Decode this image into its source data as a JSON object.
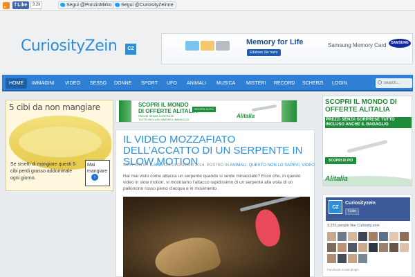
{
  "topbar": {
    "like_label": "Like",
    "like_count": "3.2k",
    "follow1": "Segui @PonzioMirko",
    "follow2": "Segui @CuriosityZeinne"
  },
  "header": {
    "logo": "CuriosityZein",
    "logo_badge": "CZ",
    "banner": {
      "title": "Memory for Life",
      "subtitle": "Samsung Memory Card",
      "cta": "Erfahren Sie mehr",
      "brand": "SAMSUNG"
    }
  },
  "nav": {
    "items": [
      "HOME",
      "IMMAGINI",
      "VIDEO",
      "SESSO",
      "DONNE",
      "SPORT",
      "UFO",
      "ANIMALI",
      "MUSICA",
      "MISTERI",
      "RECORD",
      "SCHERZI",
      "LOGIN"
    ],
    "active": "HOME",
    "search_placeholder": "search..."
  },
  "left_ad": {
    "title": "5 cibi da non mangiare",
    "text": "Se smetti di mangiare questi 5 cibi perdi grasso addominale ogni giorno.",
    "button_label": "Mai mangiare"
  },
  "ad_mid": {
    "headline_1": "SCOPRI IL MONDO",
    "headline_2": "DI OFFERTE ALITALIA",
    "sub_1": "PREZZI SENZA SORPRESE",
    "sub_2": "TUTTO INCLUSO ANCHE IL BAGAGLIO",
    "cta": "SCOPRI DI PIÙ",
    "brand": "Alitalia"
  },
  "ad_right": {
    "headline": "SCOPRI IL MONDO DI OFFERTE ALITALIA",
    "sub": "PREZZI SENZA SORPRESE TUTTO INCLUSO ANCHE IL BAGAGLIO",
    "cta": "SCOPRI DI PIÙ",
    "brand": "Alitalia"
  },
  "article": {
    "title": "IL VIDEO MOZZAFIATO DELL’ACCATTO DI UN SERPENTE IN SLOW MOTION",
    "meta_prefix": "WRITTEN BY",
    "author": "ILARIA",
    "meta_on": "ON 18 GIUGNO 2014. POSTED IN",
    "categories": "ANIMALI, QUESTO NON LO SAPEVI, VIDEO",
    "excerpt": "Hai mai visto come attacca un serpente quando si sente minacciato? Ecco che, in questo video in slow motion, vi mostriamo l’attacco rapidissimo di un serpente alla vista di un palloncino rosso pieno d’acqua e in movimento."
  },
  "fb_box": {
    "page_name": "Curiosityzein",
    "like_label": "Like",
    "badge": "CZ",
    "people_count": "3,231 people like",
    "people_link": "Curiosity.zein",
    "plugin_label": "Facebook social plugin"
  }
}
